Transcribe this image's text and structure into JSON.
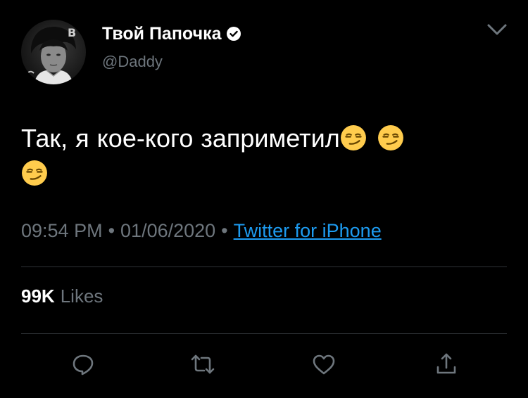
{
  "tweet": {
    "display_name": "Твой Папочка",
    "handle": "@Daddy",
    "text_part1": "Так, я кое-кого заприметил",
    "emoji_name": "smirking-face",
    "emoji_count": 3,
    "time": "09:54 PM",
    "separator": "•",
    "date": "01/06/2020",
    "source": "Twitter for iPhone",
    "likes_count": "99K",
    "likes_label": "Likes"
  },
  "colors": {
    "background": "#000000",
    "primary_text": "#ffffff",
    "secondary_text": "#6e767d",
    "link": "#1d9bf0",
    "divider": "#2f3336"
  },
  "icons": [
    "verified-badge-icon",
    "chevron-down-icon",
    "reply-icon",
    "retweet-icon",
    "like-icon",
    "share-icon"
  ]
}
